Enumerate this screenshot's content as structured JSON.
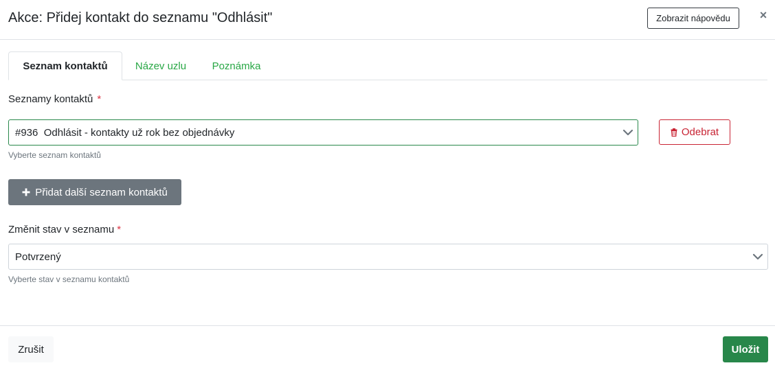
{
  "modal": {
    "title": "Akce: Přidej kontakt do seznamu \"Odhlásit\"",
    "help_label": "Zobrazit nápovědu",
    "close_glyph": "×"
  },
  "tabs": [
    {
      "label": "Seznam kontaktů",
      "active": true
    },
    {
      "label": "Název uzlu",
      "active": false
    },
    {
      "label": "Poznámka",
      "active": false
    }
  ],
  "contact_lists": {
    "label": "Seznamy kontaktů",
    "required_mark": "*",
    "selected_value": "#936  Odhlásit - kontakty už rok bez objednávky",
    "hint": "Vyberte seznam kontaktů",
    "remove_label": "Odebrat",
    "remove_icon": "trash-icon",
    "add_label": "Přidat další seznam kontaktů",
    "add_icon": "plus-icon"
  },
  "status": {
    "label": "Změnit stav v seznamu",
    "required_mark": "*",
    "selected_value": "Potvrzený",
    "hint": "Vyberte stav v seznamu kontaktů"
  },
  "footer": {
    "cancel_label": "Zrušit",
    "save_label": "Uložit"
  },
  "colors": {
    "accent_green": "#28a745",
    "save_green": "#28874a",
    "danger_red": "#c82333",
    "secondary_gray": "#6c757d"
  }
}
